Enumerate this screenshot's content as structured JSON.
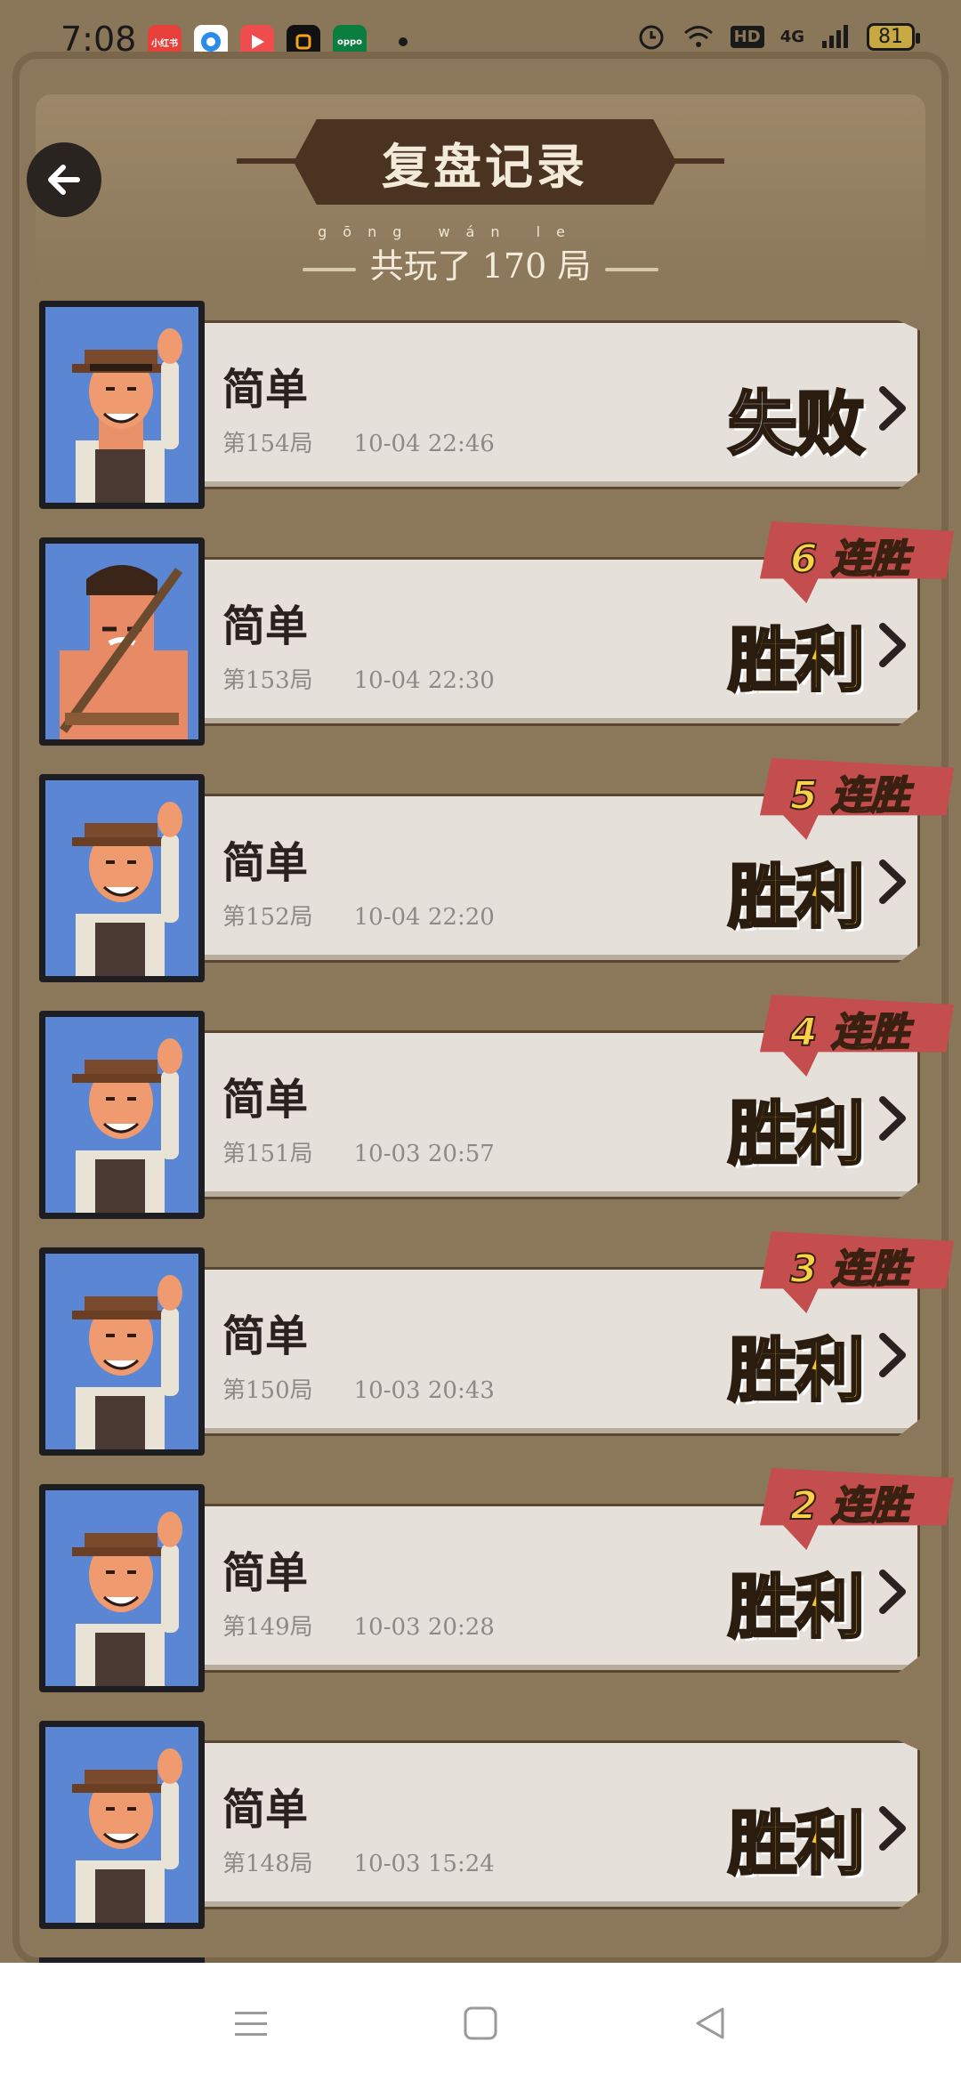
{
  "status_bar": {
    "time": "7:08",
    "apps": [
      {
        "name": "xiaohongshu-icon",
        "label": "小红书",
        "color": "#e8403b"
      },
      {
        "name": "browser-icon",
        "label": "",
        "color": "#2b8ce8"
      },
      {
        "name": "video-icon",
        "label": "",
        "color": "#ef4d4d"
      },
      {
        "name": "camera-app-icon",
        "label": "",
        "color": "#111111"
      },
      {
        "name": "oppo-icon",
        "label": "oppo",
        "color": "#0b7d3e"
      }
    ],
    "network": "4G",
    "hd": "HD",
    "battery": "81"
  },
  "header": {
    "title": "复盘记录",
    "pinyin": "gōng wán le",
    "subtitle": "共玩了 170 局"
  },
  "records": [
    {
      "difficulty": "简单",
      "game": "第154局",
      "time": "10-04  22:46",
      "result": "失败",
      "outcome": "lose",
      "streak": "",
      "avatar": "farmer"
    },
    {
      "difficulty": "简单",
      "game": "第153局",
      "time": "10-04  22:30",
      "result": "胜利",
      "outcome": "win",
      "streak": "6 连胜",
      "avatar": "warrior"
    },
    {
      "difficulty": "简单",
      "game": "第152局",
      "time": "10-04  22:20",
      "result": "胜利",
      "outcome": "win",
      "streak": "5 连胜",
      "avatar": "farmer"
    },
    {
      "difficulty": "简单",
      "game": "第151局",
      "time": "10-03  20:57",
      "result": "胜利",
      "outcome": "win",
      "streak": "4 连胜",
      "avatar": "farmer"
    },
    {
      "difficulty": "简单",
      "game": "第150局",
      "time": "10-03  20:43",
      "result": "胜利",
      "outcome": "win",
      "streak": "3 连胜",
      "avatar": "farmer"
    },
    {
      "difficulty": "简单",
      "game": "第149局",
      "time": "10-03  20:28",
      "result": "胜利",
      "outcome": "win",
      "streak": "2 连胜",
      "avatar": "farmer"
    },
    {
      "difficulty": "简单",
      "game": "第148局",
      "time": "10-03  15:24",
      "result": "胜利",
      "outcome": "win",
      "streak": "",
      "avatar": "farmer"
    }
  ],
  "colors": {
    "background": "#8a7658",
    "card": "#e5e0d9",
    "win": "#f8c826",
    "lose": "#b4a5c7",
    "streak": "#c44d4d",
    "avatar_bg": "#5a86d3"
  },
  "navbar": {
    "menu_icon": "menu-icon",
    "home_icon": "home-icon",
    "back_icon": "back-triangle-icon"
  }
}
